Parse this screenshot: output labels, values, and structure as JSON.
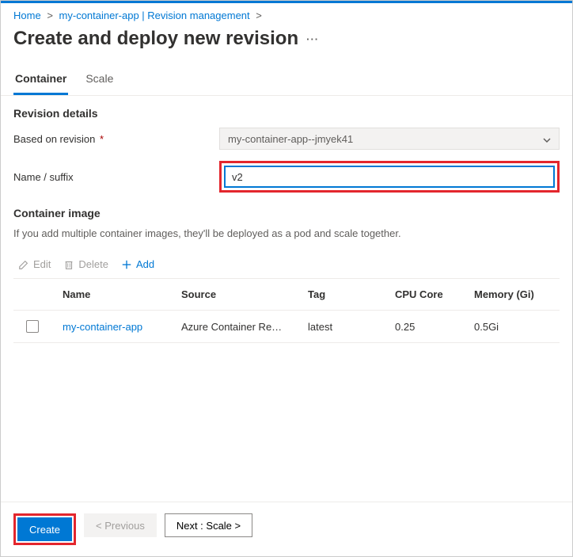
{
  "breadcrumb": {
    "home": "Home",
    "item2": "my-container-app | Revision management"
  },
  "title": "Create and deploy new revision",
  "tabs": {
    "container": "Container",
    "scale": "Scale"
  },
  "revision": {
    "section": "Revision details",
    "basedLabel": "Based on revision",
    "basedValue": "my-container-app--jmyek41",
    "suffixLabel": "Name / suffix",
    "suffixValue": "v2"
  },
  "image": {
    "section": "Container image",
    "help": "If you add multiple container images, they'll be deployed as a pod and scale together."
  },
  "toolbar": {
    "edit": "Edit",
    "delete": "Delete",
    "add": "Add"
  },
  "table": {
    "headers": {
      "name": "Name",
      "source": "Source",
      "tag": "Tag",
      "cpu": "CPU Core",
      "mem": "Memory (Gi)"
    },
    "row": {
      "name": "my-container-app",
      "source": "Azure Container Re…",
      "tag": "latest",
      "cpu": "0.25",
      "mem": "0.5Gi"
    }
  },
  "footer": {
    "create": "Create",
    "prev": "< Previous",
    "next": "Next : Scale >"
  }
}
